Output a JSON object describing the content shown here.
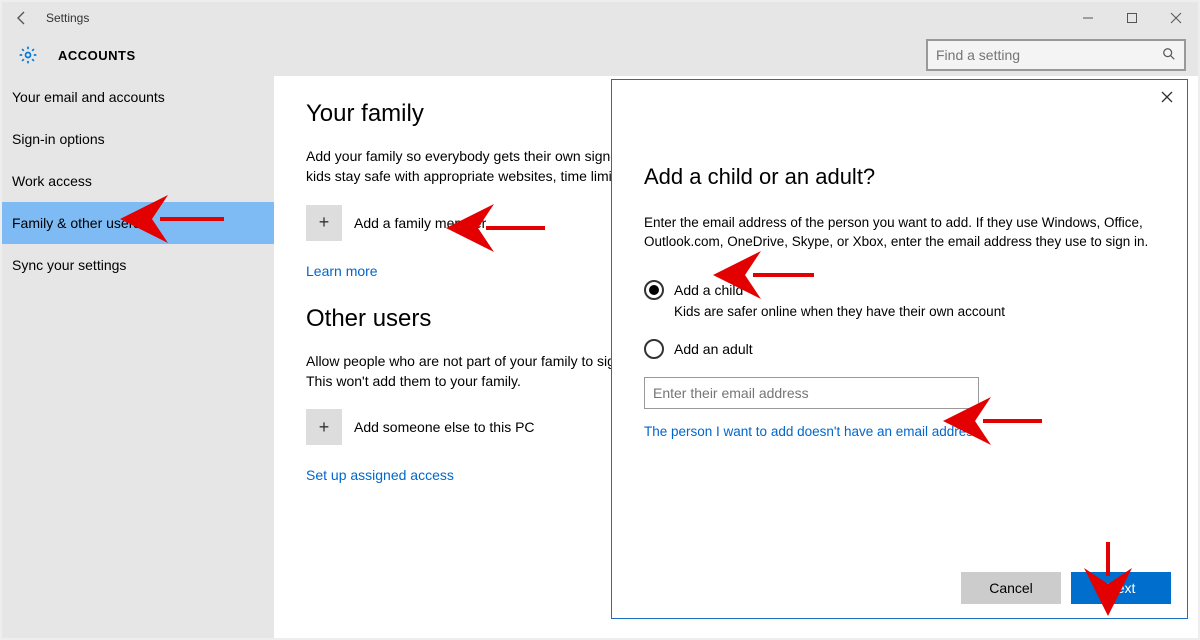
{
  "window": {
    "title": "Settings"
  },
  "header": {
    "page_title": "ACCOUNTS",
    "search_placeholder": "Find a setting"
  },
  "sidebar": {
    "items": [
      {
        "label": "Your email and accounts"
      },
      {
        "label": "Sign-in options"
      },
      {
        "label": "Work access"
      },
      {
        "label": "Family & other users"
      },
      {
        "label": "Sync your settings"
      }
    ]
  },
  "content": {
    "family_heading": "Your family",
    "family_desc": "Add your family so everybody gets their own sign-in and desktop. You can help kids stay safe with appropriate websites, time limits, apps, and games.",
    "add_member": "Add a family member",
    "learn_more": "Learn more",
    "other_heading": "Other users",
    "other_desc": "Allow people who are not part of your family to sign in with their own accounts. This won't add them to your family.",
    "add_other": "Add someone else to this PC",
    "assigned": "Set up assigned access"
  },
  "dialog": {
    "title": "Add a child or an adult?",
    "intro": "Enter the email address of the person you want to add. If they use Windows, Office, Outlook.com, OneDrive, Skype, or Xbox, enter the email address they use to sign in.",
    "radio_child": "Add a child",
    "child_sub": "Kids are safer online when they have their own account",
    "radio_adult": "Add an adult",
    "email_placeholder": "Enter their email address",
    "no_email_link": "The person I want to add doesn't have an email address",
    "cancel": "Cancel",
    "next": "Next"
  }
}
